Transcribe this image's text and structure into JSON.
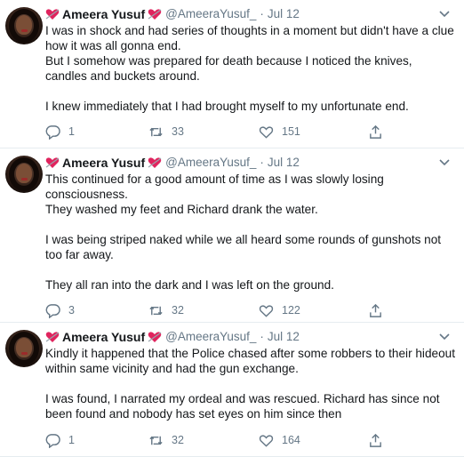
{
  "tweets": [
    {
      "author": "Ameera Yusuf",
      "handle": "@AmeeraYusuf_",
      "date": "Jul 12",
      "text": "I was in shock and had series of thoughts in a moment but didn't have a clue how it was all gonna end.\nBut I somehow was prepared for death because I noticed the knives, candles and buckets around.\n\nI knew immediately that I had brought myself to my unfortunate end.",
      "replies": "1",
      "retweets": "33",
      "likes": "151"
    },
    {
      "author": "Ameera Yusuf",
      "handle": "@AmeeraYusuf_",
      "date": "Jul 12",
      "text": "This continued for a good amount of time as I was slowly losing consciousness.\nThey washed my feet and Richard drank the water.\n\nI was being striped naked while we all heard some rounds of gunshots not too far away.\n\nThey all ran into the dark and I was left on the ground.",
      "replies": "3",
      "retweets": "32",
      "likes": "122"
    },
    {
      "author": "Ameera Yusuf",
      "handle": "@AmeeraYusuf_",
      "date": "Jul 12",
      "text": "Kindly it happened that the Police chased after some robbers to their hideout within same vicinity and had the gun exchange.\n\nI was found, I narrated my ordeal and was rescued. Richard has since not been found and nobody has set eyes on him since then",
      "replies": "1",
      "retweets": "32",
      "likes": "164"
    }
  ],
  "icons": {
    "name_decoration": "heart-with-arrow-icon",
    "reply": "reply-icon",
    "retweet": "retweet-icon",
    "like": "like-icon",
    "share": "share-icon",
    "menu": "chevron-down-icon"
  },
  "colors": {
    "text": "#14171a",
    "secondary": "#657786",
    "heart": "#e0245e",
    "divider": "#e6ecf0"
  }
}
